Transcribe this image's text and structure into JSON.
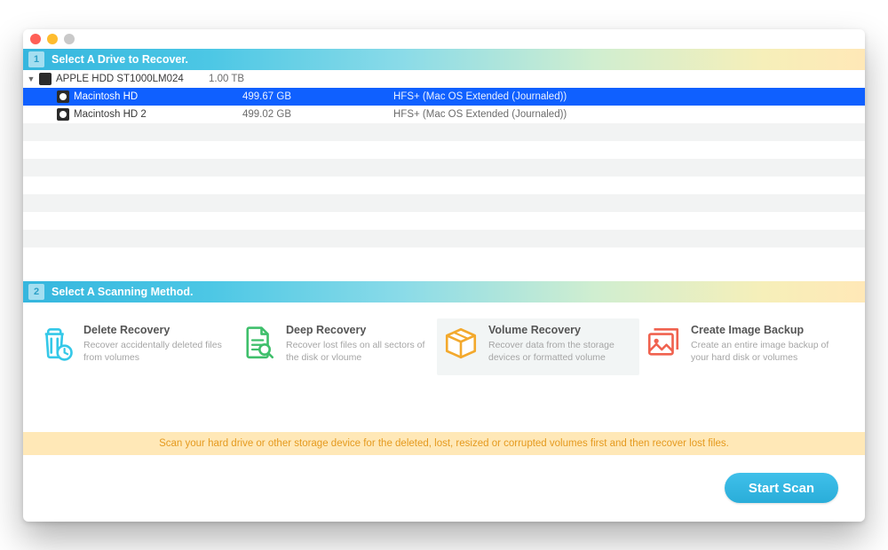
{
  "section1": {
    "num": "1",
    "title": "Select A Drive to Recover."
  },
  "section2": {
    "num": "2",
    "title": "Select A Scanning Method."
  },
  "drives": {
    "device": {
      "name": "APPLE HDD ST1000LM024",
      "size": "1.00 TB"
    },
    "vol1": {
      "name": "Macintosh HD",
      "size": "499.67 GB",
      "fs": "HFS+ (Mac OS Extended (Journaled))"
    },
    "vol2": {
      "name": "Macintosh HD 2",
      "size": "499.02 GB",
      "fs": "HFS+ (Mac OS Extended (Journaled))"
    }
  },
  "methods": {
    "m0": {
      "title": "Delete Recovery",
      "desc": "Recover accidentally deleted files from volumes"
    },
    "m1": {
      "title": "Deep Recovery",
      "desc": "Recover lost files on all sectors of the disk or vloume"
    },
    "m2": {
      "title": "Volume Recovery",
      "desc": "Recover data from the storage devices or formatted volume"
    },
    "m3": {
      "title": "Create Image Backup",
      "desc": "Create an entire image backup of your hard disk or volumes"
    }
  },
  "hint": "Scan your hard drive or other storage device for the deleted, lost, resized or corrupted volumes first and then recover lost files.",
  "buttons": {
    "start": "Start Scan"
  },
  "colors": {
    "delete": "#34c8e8",
    "deep": "#3fbf6b",
    "volume": "#f3a92d",
    "backup": "#f0624f"
  }
}
